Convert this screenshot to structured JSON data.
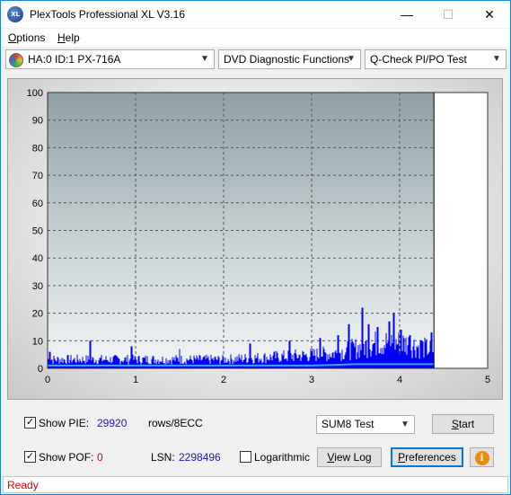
{
  "window": {
    "title": "PlexTools Professional XL V3.16",
    "app_icon_text": "XL",
    "minimize_glyph": "—",
    "maximize_glyph": "☐",
    "close_glyph": "✕"
  },
  "menu": {
    "options": {
      "accel": "O",
      "rest": "ptions"
    },
    "help": {
      "accel": "H",
      "rest": "elp"
    }
  },
  "toolbar": {
    "drive": "HA:0 ID:1  PX-716A",
    "function": "DVD Diagnostic Functions",
    "test": "Q-Check PI/PO Test"
  },
  "chart_data": {
    "type": "bar",
    "xlim": [
      0,
      5
    ],
    "ylim": [
      0,
      100
    ],
    "x_ticks": [
      "0",
      "1",
      "2",
      "3",
      "4",
      "5"
    ],
    "y_ticks": [
      "0",
      "10",
      "20",
      "30",
      "40",
      "50",
      "60",
      "70",
      "80",
      "90",
      "100"
    ],
    "test_end_x": 4.39,
    "grid": true,
    "series": [
      {
        "color": "#0000ff",
        "profile": [
          [
            0.0,
            4
          ],
          [
            0.5,
            4
          ],
          [
            1.0,
            4
          ],
          [
            1.5,
            4
          ],
          [
            2.0,
            4
          ],
          [
            2.5,
            5
          ],
          [
            3.0,
            6
          ],
          [
            3.3,
            7
          ],
          [
            3.5,
            9
          ],
          [
            3.7,
            11
          ],
          [
            3.9,
            12
          ],
          [
            4.1,
            11
          ],
          [
            4.3,
            9
          ],
          [
            4.39,
            8
          ]
        ],
        "peaks": [
          [
            0.03,
            6
          ],
          [
            0.48,
            10
          ],
          [
            0.95,
            8
          ],
          [
            1.5,
            7
          ],
          [
            2.3,
            9
          ],
          [
            2.75,
            10
          ],
          [
            3.1,
            11
          ],
          [
            3.3,
            12
          ],
          [
            3.42,
            16
          ],
          [
            3.58,
            22
          ],
          [
            3.65,
            16
          ],
          [
            3.75,
            15
          ],
          [
            3.88,
            17
          ],
          [
            3.93,
            20
          ],
          [
            4.02,
            14
          ],
          [
            4.12,
            12
          ],
          [
            4.25,
            10
          ],
          [
            4.36,
            13
          ]
        ]
      },
      {
        "color": "#38a8ff",
        "profile": [
          [
            0.0,
            1
          ],
          [
            1.0,
            1
          ],
          [
            2.0,
            1
          ],
          [
            3.0,
            1
          ],
          [
            3.5,
            1.5
          ],
          [
            4.0,
            1.5
          ],
          [
            4.39,
            1.5
          ]
        ]
      }
    ]
  },
  "status": {
    "show_pie_label": "Show PIE:",
    "pie_value": "29920",
    "pie_unit": "rows/8ECC",
    "show_pof_label": "Show POF:",
    "pof_value": "0",
    "lsn_label": "LSN:",
    "lsn_value": "2298496",
    "logarithmic_label": "Logarithmic",
    "sum_select": "SUM8 Test",
    "start": {
      "accel": "S",
      "rest": "tart"
    },
    "view_log": {
      "accel": "V",
      "rest": "iew Log"
    },
    "preferences": {
      "accel": "P",
      "rest": "references"
    },
    "info_glyph": "i"
  },
  "statusbar": {
    "text": "Ready"
  }
}
